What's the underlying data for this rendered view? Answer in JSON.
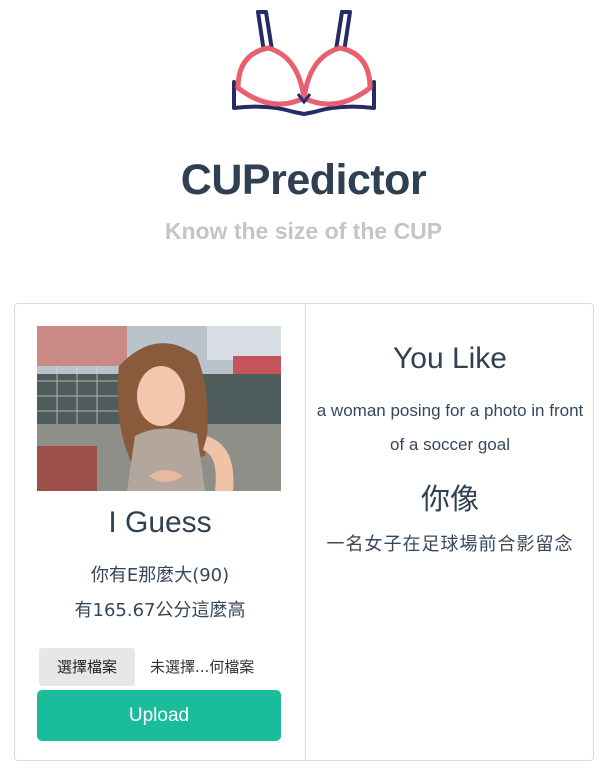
{
  "app": {
    "title": "CUPredictor",
    "subtitle": "Know the size of the CUP",
    "logo_icon": "bra-icon",
    "colors": {
      "title": "#2f4053",
      "subtitle": "#c3c5c8",
      "accent": "#1abc9c",
      "logo_cup": "#e8606f",
      "logo_strap": "#262a66"
    }
  },
  "guess": {
    "title": "I Guess",
    "cup_line": "你有E那麼大(90)",
    "height_line": "有165.67公分這麼高"
  },
  "upload": {
    "choose_file_label": "選擇檔案",
    "file_name": "未選擇...何檔案",
    "upload_label": "Upload"
  },
  "like": {
    "title": "You Like",
    "description": "a woman posing for a photo in front of a soccer goal",
    "zh_title": "你像",
    "zh_description": "一名女子在足球場前合影留念"
  }
}
